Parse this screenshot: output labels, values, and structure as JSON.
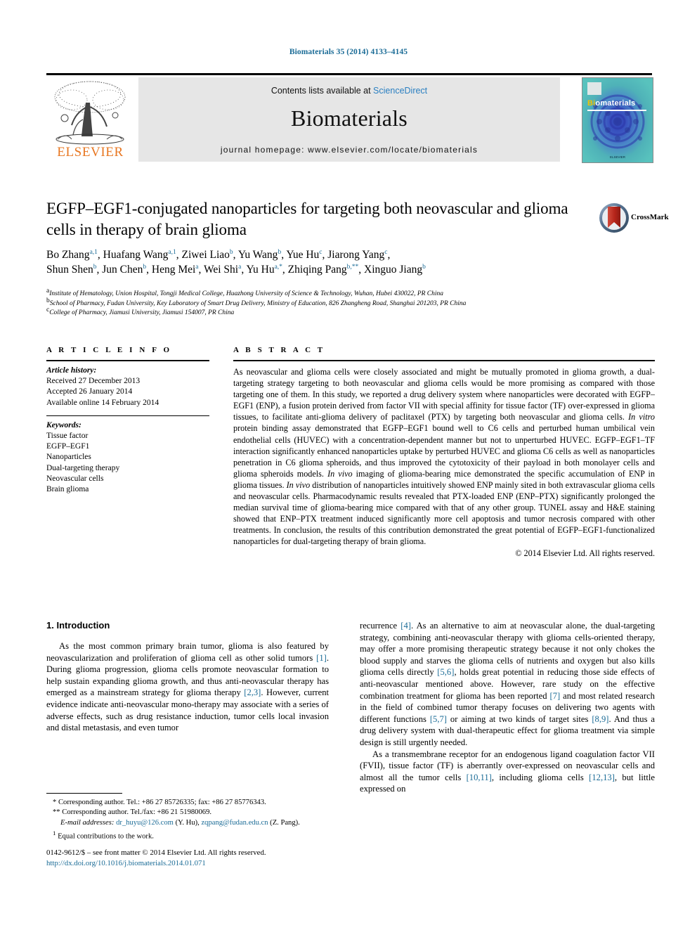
{
  "running_head": "Biomaterials 35 (2014) 4133–4145",
  "masthead": {
    "contents_prefix": "Contents lists available at ",
    "contents_link": "ScienceDirect",
    "journal_title": "Biomaterials",
    "homepage": "journal homepage: www.elsevier.com/locate/biomaterials",
    "publisher": "ELSEVIER",
    "cover": {
      "title_part1": "Bi",
      "title_part2": "omaterials",
      "footer": "ELSEVIER"
    }
  },
  "article": {
    "title": "EGFP–EGF1-conjugated nanoparticles for targeting both neovascular and glioma cells in therapy of brain glioma",
    "crossmark_label": "CrossMark",
    "authors": [
      {
        "name": "Bo Zhang",
        "marks": "a,1"
      },
      {
        "name": "Huafang Wang",
        "marks": "a,1"
      },
      {
        "name": "Ziwei Liao",
        "marks": "b"
      },
      {
        "name": "Yu Wang",
        "marks": "b"
      },
      {
        "name": "Yue Hu",
        "marks": "c"
      },
      {
        "name": "Jiarong Yang",
        "marks": "c"
      },
      {
        "name": "Shun Shen",
        "marks": "b"
      },
      {
        "name": "Jun Chen",
        "marks": "b"
      },
      {
        "name": "Heng Mei",
        "marks": "a"
      },
      {
        "name": "Wei Shi",
        "marks": "a"
      },
      {
        "name": "Yu Hu",
        "marks": "a,*"
      },
      {
        "name": "Zhiqing Pang",
        "marks": "b,**"
      },
      {
        "name": "Xinguo Jiang",
        "marks": "b"
      }
    ],
    "affiliations": [
      {
        "mark": "a",
        "text": "Institute of Hematology, Union Hospital, Tongji Medical College, Huazhong University of Science & Technology, Wuhan, Hubei 430022, PR China"
      },
      {
        "mark": "b",
        "text": "School of Pharmacy, Fudan University, Key Laboratory of Smart Drug Delivery, Ministry of Education, 826 Zhangheng Road, Shanghai 201203, PR China"
      },
      {
        "mark": "c",
        "text": "College of Pharmacy, Jiamusi University, Jiamusi 154007, PR China"
      }
    ]
  },
  "article_info": {
    "heading": "A R T I C L E   I N F O",
    "history_label": "Article history:",
    "history": [
      "Received 27 December 2013",
      "Accepted 26 January 2014",
      "Available online 14 February 2014"
    ],
    "keywords_label": "Keywords:",
    "keywords": [
      "Tissue factor",
      "EGFP–EGF1",
      "Nanoparticles",
      "Dual-targeting therapy",
      "Neovascular cells",
      "Brain glioma"
    ]
  },
  "abstract": {
    "heading": "A B S T R A C T",
    "paragraph_html": "As neovascular and glioma cells were closely associated and might be mutually promoted in glioma growth, a dual-targeting strategy targeting to both neovascular and glioma cells would be more promising as compared with those targeting one of them. In this study, we reported a drug delivery system where nanoparticles were decorated with EGFP–EGF1 (ENP), a fusion protein derived from factor VII with special affinity for tissue factor (TF) over-expressed in glioma tissues, to facilitate anti-glioma delivery of paclitaxel (PTX) by targeting both neovascular and glioma cells. <i>In vitro</i> protein binding assay demonstrated that EGFP–EGF1 bound well to C6 cells and perturbed human umbilical vein endothelial cells (HUVEC) with a concentration-dependent manner but not to unperturbed HUVEC. EGFP–EGF1–TF interaction significantly enhanced nanoparticles uptake by perturbed HUVEC and glioma C6 cells as well as nanoparticles penetration in C6 glioma spheroids, and thus improved the cytotoxicity of their payload in both monolayer cells and glioma spheroids models. <i>In vivo</i> imaging of glioma-bearing mice demonstrated the specific accumulation of ENP in glioma tissues. <i>In vivo</i> distribution of nanoparticles intuitively showed ENP mainly sited in both extravascular glioma cells and neovascular cells. Pharmacodynamic results revealed that PTX-loaded ENP (ENP–PTX) significantly prolonged the median survival time of glioma-bearing mice compared with that of any other group. TUNEL assay and H&amp;E staining showed that ENP–PTX treatment induced significantly more cell apoptosis and tumor necrosis compared with other treatments. In conclusion, the results of this contribution demonstrated the great potential of EGFP–EGF1-functionalized nanoparticles for dual-targeting therapy of brain glioma.",
    "copyright": "© 2014 Elsevier Ltd. All rights reserved."
  },
  "body": {
    "section_heading": "1. Introduction",
    "left_paragraph_html": "As the most common primary brain tumor, glioma is also featured by neovascularization and proliferation of glioma cell as other solid tumors <span class=\"ref\">[1]</span>. During glioma progression, glioma cells promote neovascular formation to help sustain expanding glioma growth, and thus anti-neovascular therapy has emerged as a mainstream strategy for glioma therapy <span class=\"ref\">[2,3]</span>. However, current evidence indicate anti-neovascular mono-therapy may associate with a series of adverse effects, such as drug resistance induction, tumor cells local invasion and distal metastasis, and even tumor",
    "right_paragraph1_html": "recurrence <span class=\"ref\">[4]</span>. As an alternative to aim at neovascular alone, the dual-targeting strategy, combining anti-neovascular therapy with glioma cells-oriented therapy, may offer a more promising therapeutic strategy because it not only chokes the blood supply and starves the glioma cells of nutrients and oxygen but also kills glioma cells directly <span class=\"ref\">[5,6]</span>, holds great potential in reducing those side effects of anti-neovascular mentioned above. However, rare study on the effective combination treatment for glioma has been reported <span class=\"ref\">[7]</span> and most related research in the field of combined tumor therapy focuses on delivering two agents with different functions <span class=\"ref\">[5,7]</span> or aiming at two kinds of target sites <span class=\"ref\">[8,9]</span>. And thus a drug delivery system with dual-therapeutic effect for glioma treatment via simple design is still urgently needed.",
    "right_paragraph2_html": "As a transmembrane receptor for an endogenous ligand coagulation factor VII (FVII), tissue factor (TF) is aberrantly over-expressed on neovascular cells and almost all the tumor cells <span class=\"ref\">[10,11]</span>, including glioma cells <span class=\"ref\">[12,13]</span>, but little expressed on"
  },
  "footnotes": {
    "corresponding1_mark": "*",
    "corresponding1": "Corresponding author. Tel.: +86 27 85726335; fax: +86 27 85776343.",
    "corresponding2_mark": "**",
    "corresponding2": "Corresponding author. Tel./fax: +86 21 51980069.",
    "email_label": "E-mail addresses:",
    "email1": "dr_huyu@126.com",
    "email1_owner": "(Y. Hu)",
    "email2": "zqpang@fudan.edu.cn",
    "email2_owner": "(Z. Pang).",
    "equal_mark": "1",
    "equal_contrib": "Equal contributions to the work."
  },
  "imprint": {
    "line1": "0142-9612/$ – see front matter © 2014 Elsevier Ltd. All rights reserved.",
    "doi": "http://dx.doi.org/10.1016/j.biomaterials.2014.01.071"
  },
  "colors": {
    "link": "#1a6b96",
    "sciencedirect": "#2a7fc1",
    "elsevier_orange": "#e87722",
    "cover_teal": "#3fb0ad"
  }
}
